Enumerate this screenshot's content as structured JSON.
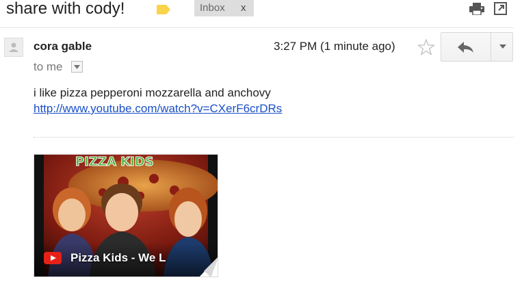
{
  "thread": {
    "subject": "share with cody!",
    "label_chip": "Inbox",
    "label_remove": "x"
  },
  "message": {
    "sender": "cora gable",
    "timestamp": "3:27 PM (1 minute ago)",
    "recipients": "to me",
    "body": "i like pizza pepperoni mozzarella and anchovy",
    "link": "http://www.youtube.com/watch?v=CXerF6crDRs"
  },
  "attachment": {
    "video_title": "Pizza Kids - We L",
    "thumbnail_banner": "PIZZA KIDS"
  },
  "colors": {
    "label_tag": "#f9d34a",
    "link": "#1a4fc6",
    "youtube_red": "#e62117"
  },
  "icons": [
    "label-tag-icon",
    "print-icon",
    "popout-icon",
    "avatar-icon",
    "star-icon",
    "reply-icon",
    "chevron-down-icon",
    "youtube-icon"
  ]
}
